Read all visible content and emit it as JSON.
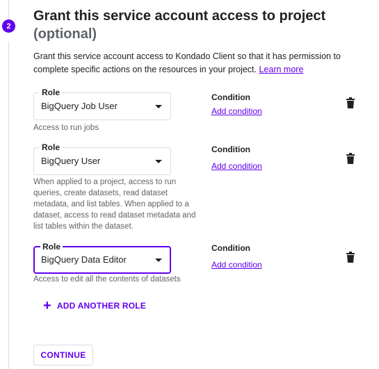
{
  "step": {
    "number": "2",
    "title": "Grant this service account access to project",
    "subtitle": "(optional)"
  },
  "description": {
    "text": "Grant this service account access to Kondado Client so that it has permission to complete specific actions on the resources in your project.",
    "link": "Learn more"
  },
  "roles": [
    {
      "label": "Role",
      "value": "BigQuery Job User",
      "helper": "Access to run jobs",
      "condition_title": "Condition",
      "condition_link": "Add condition"
    },
    {
      "label": "Role",
      "value": "BigQuery User",
      "helper": "When applied to a project, access to run queries, create datasets, read dataset metadata, and list tables. When applied to a dataset, access to read dataset metadata and list tables within the dataset.",
      "condition_title": "Condition",
      "condition_link": "Add condition"
    },
    {
      "label": "Role",
      "value": "BigQuery Data Editor",
      "helper": "Access to edit all the contents of datasets",
      "condition_title": "Condition",
      "condition_link": "Add condition"
    }
  ],
  "actions": {
    "add_role": "ADD ANOTHER ROLE",
    "continue": "CONTINUE"
  },
  "icons": {
    "add": "plus-icon",
    "delete": "trash-icon",
    "dropdown": "caret-down-icon"
  },
  "colors": {
    "accent": "#6200ee",
    "text": "#202124",
    "muted": "#5f6368",
    "border": "#dadce0"
  }
}
